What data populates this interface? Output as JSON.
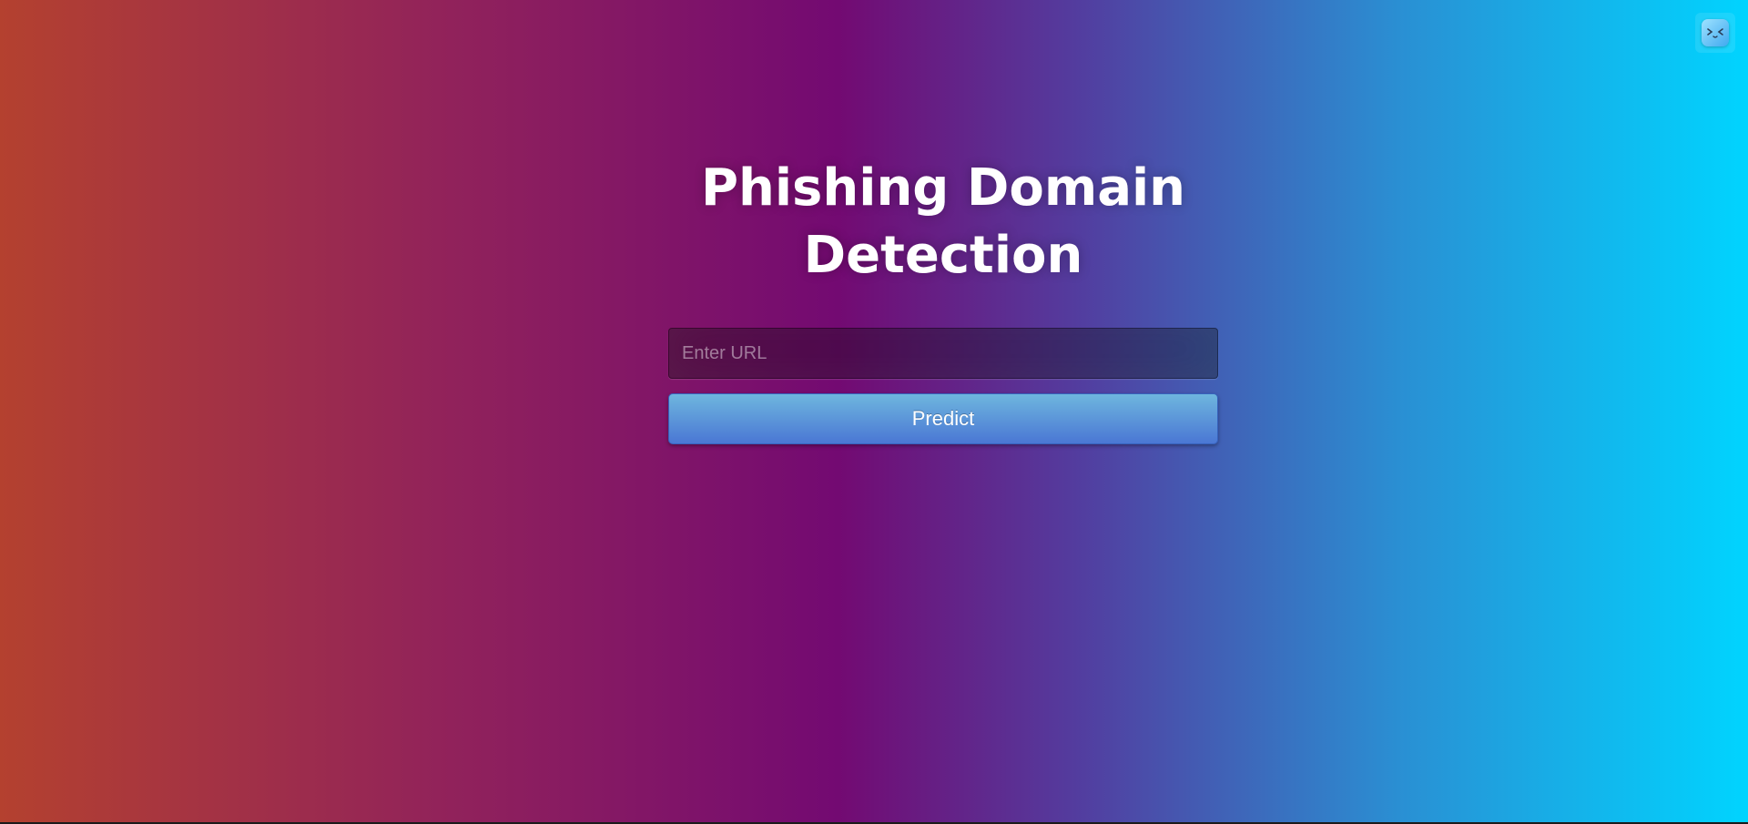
{
  "page": {
    "title": "Phishing Domain Detection"
  },
  "form": {
    "url_placeholder": "Enter URL",
    "url_value": "",
    "predict_label": "Predict"
  },
  "extension": {
    "icon": "extension-face-icon"
  },
  "colors": {
    "gradient": [
      "#b4412f",
      "#730a72",
      "#00d4ff"
    ],
    "button_top": "#6eb6de",
    "button_bottom": "#4a77d4"
  }
}
